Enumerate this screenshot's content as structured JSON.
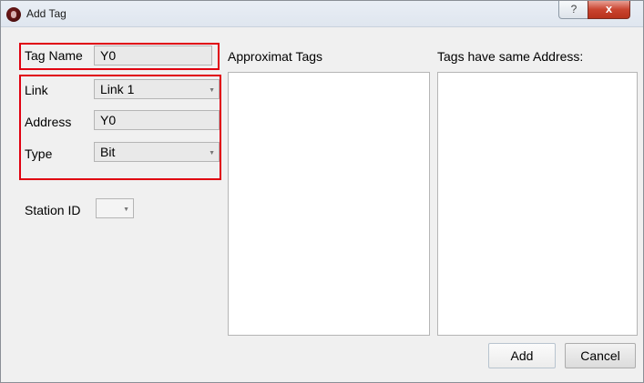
{
  "window": {
    "title": "Add Tag",
    "help_label": "?",
    "close_label": "x"
  },
  "form": {
    "tag_name": {
      "label": "Tag Name",
      "value": "Y0"
    },
    "link": {
      "label": "Link",
      "value": "Link 1"
    },
    "address": {
      "label": "Address",
      "value": "Y0"
    },
    "type": {
      "label": "Type",
      "value": "Bit"
    },
    "station_id": {
      "label": "Station ID",
      "value": ""
    }
  },
  "lists": {
    "approximate_tags_label": "Approximat Tags",
    "same_address_label": "Tags have same Address:"
  },
  "buttons": {
    "add": "Add",
    "cancel": "Cancel"
  },
  "colors": {
    "highlight": "#e00010",
    "window_bg": "#f0f0f0",
    "close_button": "#c9442f"
  },
  "icons": {
    "app": "app-icon",
    "dropdown": "chevron-down-icon"
  }
}
